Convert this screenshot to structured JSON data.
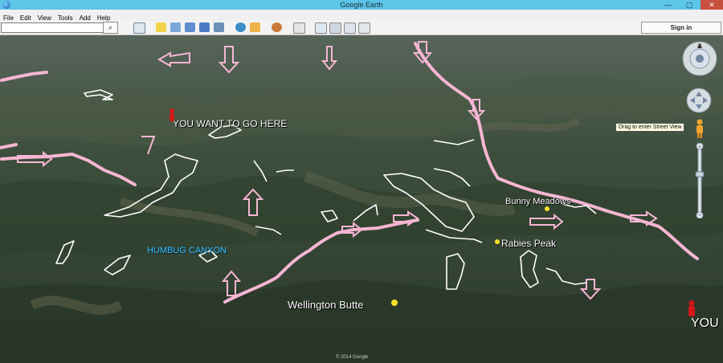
{
  "window": {
    "title": "Google Earth",
    "minimize": "—",
    "maximize": "▢",
    "close": "✕"
  },
  "menu": [
    "File",
    "Edit",
    "View",
    "Tools",
    "Add",
    "Help"
  ],
  "toolbar": {
    "search_value": "",
    "search_icon": "search-icon",
    "signin_label": "Sign in"
  },
  "tooltip": "Drag to enter Street View",
  "map": {
    "labels": {
      "go_here": "YOU WANT TO GO HERE",
      "humbug": "HUMBUG CANYON",
      "bunny": "Bunny Meadows",
      "rabies": "Rabies Peak",
      "wellington": "Wellington Butte",
      "you": "YOU"
    },
    "copyright": "© 2014 Google",
    "colors": {
      "route": "#f6b6d3",
      "outline": "#ffffff",
      "pin_yellow": "#f5e12a",
      "person_red": "#d21818"
    }
  }
}
